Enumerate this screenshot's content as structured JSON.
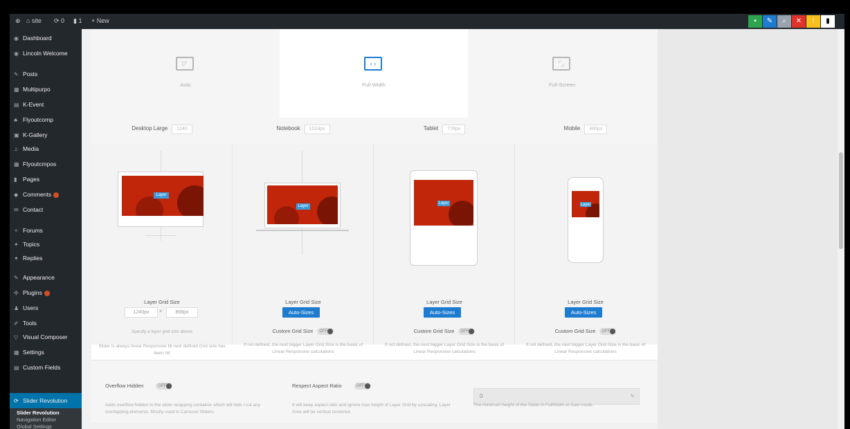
{
  "adminbar": {
    "items": [
      "⊕",
      "⌂ site",
      "⟳ 0",
      "▮ 1",
      "+ New"
    ],
    "color_buttons": [
      {
        "icon": "save-icon",
        "glyph": "▪",
        "color": "#2ea44f"
      },
      {
        "icon": "edit-icon",
        "glyph": "✎",
        "color": "#1e7cd0"
      },
      {
        "icon": "search-icon",
        "glyph": "⌕",
        "color": "#9aa3ad"
      },
      {
        "icon": "close-icon",
        "glyph": "✕",
        "color": "#e0312b"
      },
      {
        "icon": "warning-icon",
        "glyph": "!",
        "color": "#f7c01c"
      },
      {
        "icon": "exit-icon",
        "glyph": "▮",
        "color": "#ffffff"
      }
    ]
  },
  "sidebar": {
    "items": [
      {
        "label": "Dashboard",
        "icon": "dashboard-icon"
      },
      {
        "label": "Lincoln Welcome",
        "icon": "welcome-icon"
      },
      {
        "label": "Posts",
        "icon": "pin-icon"
      },
      {
        "label": "Multipurpo",
        "icon": "grid-icon"
      },
      {
        "label": "K-Event",
        "icon": "calendar-icon"
      },
      {
        "label": "Flyoutcomp",
        "icon": "people-icon"
      },
      {
        "label": "K-Gallery",
        "icon": "gallery-icon"
      },
      {
        "label": "Media",
        "icon": "media-icon"
      },
      {
        "label": "Flyoutcmpos",
        "icon": "grid-icon"
      },
      {
        "label": "Pages",
        "icon": "page-icon"
      },
      {
        "label": "Comments",
        "icon": "comment-icon",
        "badge": true
      },
      {
        "label": "Contact",
        "icon": "mail-icon"
      },
      {
        "label": "Forums",
        "icon": "forum-icon"
      },
      {
        "label": "Topics",
        "icon": "topic-icon"
      },
      {
        "label": "Replies",
        "icon": "reply-icon"
      },
      {
        "label": "Appearance",
        "icon": "brush-icon"
      },
      {
        "label": "Plugins",
        "icon": "plug-icon",
        "badge": true
      },
      {
        "label": "Users",
        "icon": "user-icon"
      },
      {
        "label": "Tools",
        "icon": "wrench-icon"
      },
      {
        "label": "Visual Composer",
        "icon": "composer-icon"
      },
      {
        "label": "Settings",
        "icon": "settings-icon"
      },
      {
        "label": "Custom Fields",
        "icon": "fields-icon"
      }
    ],
    "active": {
      "label": "Slider Revolution",
      "icon": "refresh-icon"
    },
    "submenu": [
      "Slider Revolution",
      "Navigation Editor",
      "Global Settings"
    ]
  },
  "layout_types": [
    {
      "label": "Auto",
      "icon": "auto-layout-icon",
      "active": false
    },
    {
      "label": "Full-Width",
      "icon": "fullwidth-layout-icon",
      "active": true
    },
    {
      "label": "Full-Screen",
      "icon": "fullscreen-layout-icon",
      "active": false
    }
  ],
  "devices": [
    {
      "name": "Desktop Large",
      "value": "1240"
    },
    {
      "name": "Notebook",
      "value": "1024px"
    },
    {
      "name": "Tablet",
      "value": "778px"
    },
    {
      "name": "Mobile",
      "value": "480px"
    }
  ],
  "grid": {
    "layer_grid_label": "Layer Grid Size",
    "width_value": "1240px",
    "height_value": "868px",
    "specify_note": "Specify a layer grid size above",
    "auto_button": "Auto-Sizes",
    "custom_label": "Custom Grid Size",
    "toggle_off": "OFF",
    "desktop_note": "Slider is always linear Responsive till next defined Grid size has been hit",
    "device_note": "If not defined, the next bigger Layer Grid Size is the basic of Linear Responsive calculations"
  },
  "layer_text": "Layer",
  "bottom": {
    "overflow_label": "Overflow Hidden",
    "respect_label": "Respect Aspect Ratio",
    "height_value": "0",
    "overflow_note": "Adds overflow:hidden to the slider wrapping container which will hide / cut any overlapping elements. Mostly used in Carousel Sliders.",
    "respect_note": "It will keep aspect ratio and ignore max height of Layer Grid by upscaling. Layer Area will be vertical centered.",
    "height_note": "The minimum height of the Slider in FullWidth or Auto mode."
  }
}
